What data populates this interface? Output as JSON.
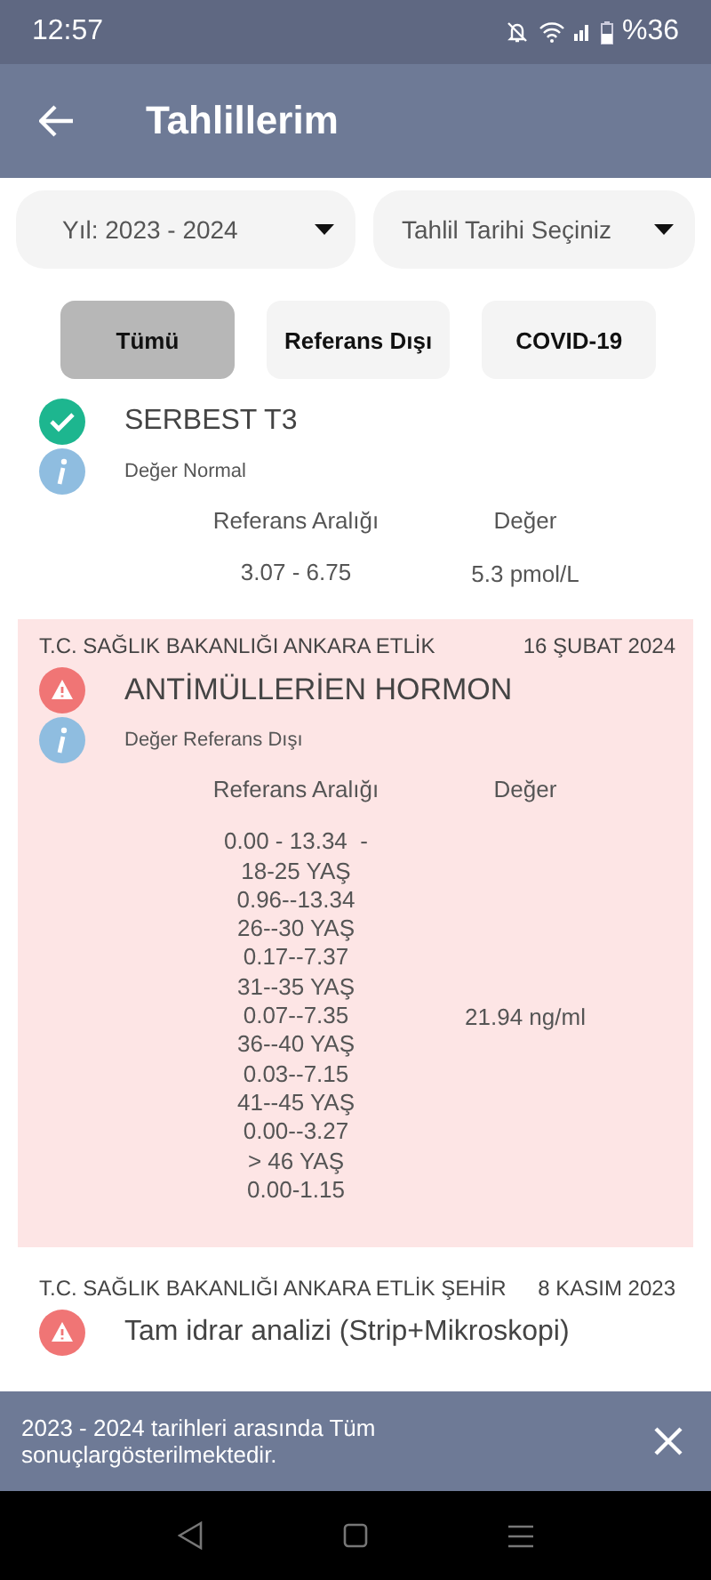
{
  "status_bar": {
    "time": "12:57",
    "battery": "%36"
  },
  "header": {
    "title": "Tahlillerim"
  },
  "dropdowns": [
    {
      "value": "Yıl: 2023 - 2024"
    },
    {
      "value": "Tahlil Tarihi Seçiniz"
    }
  ],
  "filters": [
    {
      "label": "Tümü",
      "selected": true
    },
    {
      "label": "Referans Dışı",
      "selected": false
    },
    {
      "label": "COVID-19",
      "selected": false
    }
  ],
  "results": [
    {
      "kind": "normal",
      "name": "SERBEST T3",
      "note": "Değer Normal",
      "range_heading": "Referans Aralığı",
      "value_heading": "Değer",
      "range": [
        "3.07 - 6.75"
      ],
      "value": "5.3 pmol/L"
    },
    {
      "kind": "abnormal",
      "institution": "T.C. SAĞLIK BAKANLIĞI ANKARA ETLİK",
      "date": "16 ŞUBAT 2024",
      "name": "ANTİMÜLLERİEN HORMON",
      "note": "Değer Referans Dışı",
      "range_heading": "Referans Aralığı",
      "value_heading": "Değer",
      "range": [
        "0.00 - 13.34  -",
        "18-25 YAŞ",
        "0.96--13.34",
        "26--30 YAŞ",
        "0.17--7.37",
        "31--35 YAŞ",
        "0.07--7.35",
        "36--40 YAŞ",
        "0.03--7.15",
        "41--45 YAŞ",
        "0.00--3.27",
        "> 46 YAŞ",
        "0.00-1.15"
      ],
      "value": "21.94 ng/ml"
    },
    {
      "kind": "abnormal",
      "institution": "T.C. SAĞLIK BAKANLIĞI ANKARA ETLİK ŞEHİR",
      "date": "8 KASIM 2023",
      "name": "Tam idrar analizi (Strip+Mikroskopi)"
    }
  ],
  "snackbar": {
    "message": "2023 - 2024 tarihleri arasında Tüm sonuçlargösterilmektedir."
  }
}
